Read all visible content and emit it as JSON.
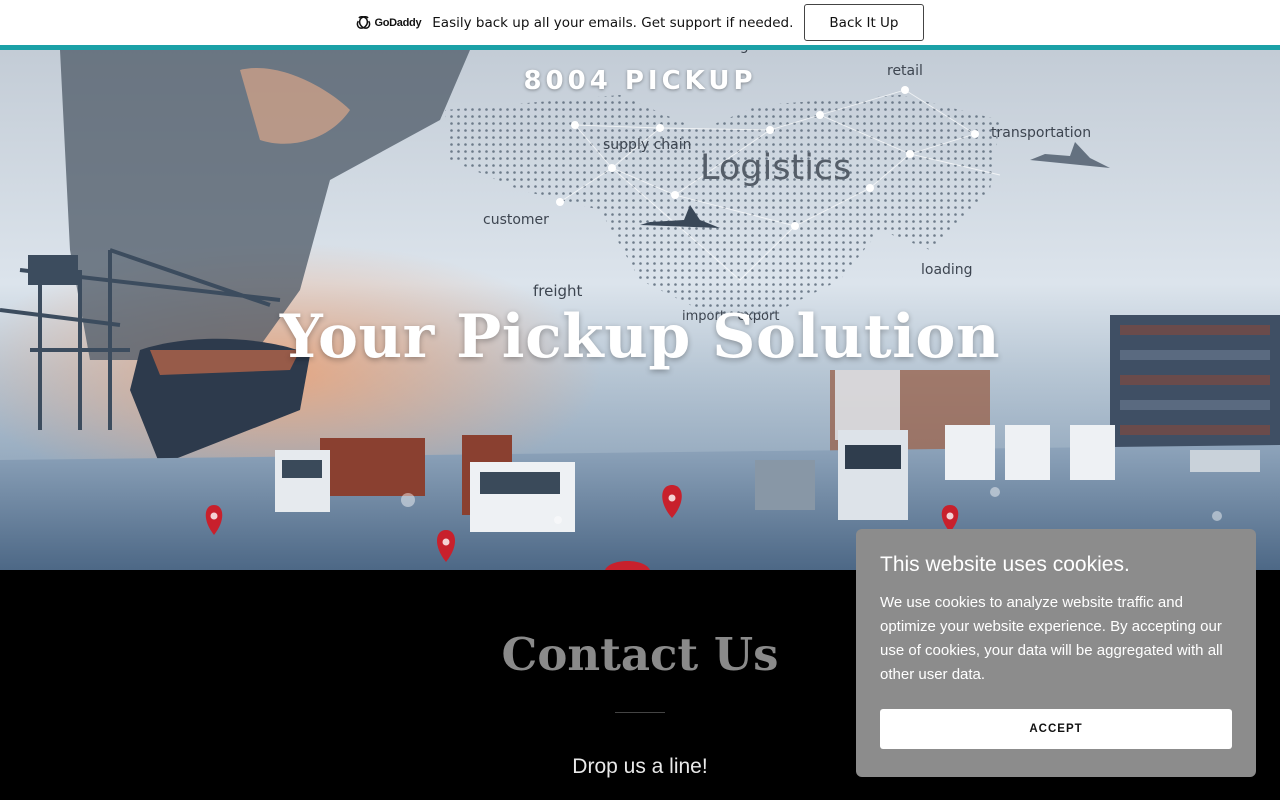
{
  "promo": {
    "logo_text": "GoDaddy",
    "message": "Easily back up all your emails. Get support if needed.",
    "button_label": "Back It Up",
    "accent_color": "#1ba1a7"
  },
  "hero": {
    "site_title": "8004 PICKUP",
    "headline": "Your Pickup Solution",
    "background_words": [
      "cargo",
      "retail",
      "supply chain",
      "transportation",
      "Logistics",
      "customer",
      "loading",
      "freight",
      "import · export"
    ]
  },
  "contact": {
    "title": "Contact Us",
    "subtitle": "Drop us a line!"
  },
  "cookie_banner": {
    "title": "This website uses cookies.",
    "body": "We use cookies to analyze website traffic and optimize your website experience. By accepting our use of cookies, your data will be aggregated with all other user data.",
    "accept_label": "ACCEPT"
  }
}
